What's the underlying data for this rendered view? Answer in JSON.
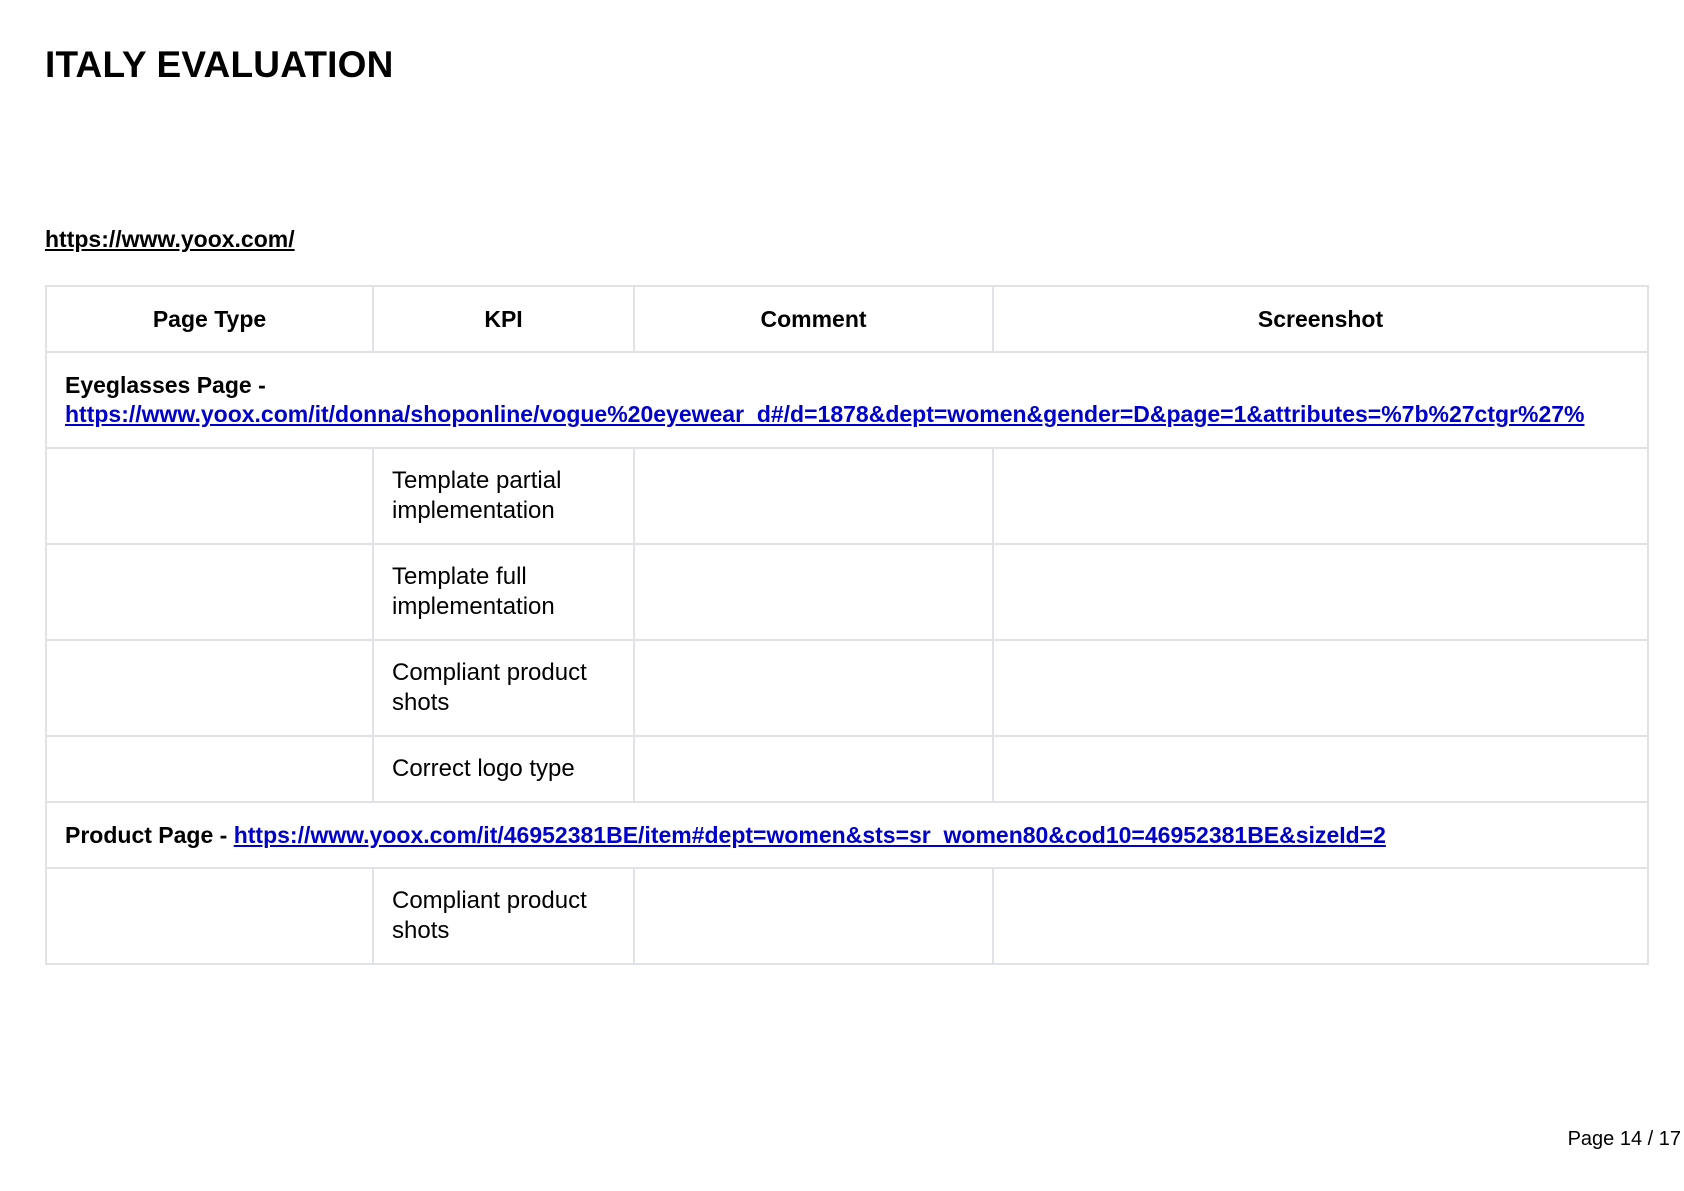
{
  "title": "ITALY EVALUATION",
  "site_url": "https://www.yoox.com/",
  "table": {
    "headers": {
      "page_type": "Page Type",
      "kpi": "KPI",
      "comment": "Comment",
      "screenshot": "Screenshot"
    },
    "eyeglasses_section": {
      "label": "Eyeglasses Page -",
      "url": "https://www.yoox.com/it/donna/shoponline/vogue%20eyewear_d#/d=1878&dept=women&gender=D&page=1&attributes=%7b%27ctgr%27%"
    },
    "eyeglasses_rows": [
      {
        "kpi": "Template partial implementation"
      },
      {
        "kpi": "Template full implementation"
      },
      {
        "kpi": "Compliant product shots"
      },
      {
        "kpi": "Correct logo type"
      }
    ],
    "product_section": {
      "label": "Product Page -",
      "url": "https://www.yoox.com/it/46952381BE/item#dept=women&sts=sr_women80&cod10=46952381BE&sizeId=2"
    },
    "product_rows": [
      {
        "kpi": "Compliant product shots"
      }
    ]
  },
  "footer": {
    "page_number": "Page 14 / 17"
  }
}
